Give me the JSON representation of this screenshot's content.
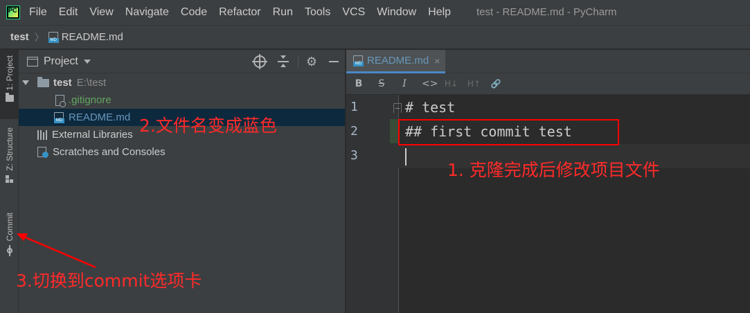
{
  "app": {
    "logo_text": "PC",
    "window_title": "test - README.md - PyCharm"
  },
  "menu": [
    "File",
    "Edit",
    "View",
    "Navigate",
    "Code",
    "Refactor",
    "Run",
    "Tools",
    "VCS",
    "Window",
    "Help"
  ],
  "breadcrumb": {
    "project": "test",
    "file": "README.md"
  },
  "tool_stripe": {
    "project": "1: Project",
    "structure": "Z: Structure",
    "commit": "Commit"
  },
  "project_panel": {
    "title": "Project",
    "tree": {
      "root_name": "test",
      "root_path": "E:\\test",
      "files": [
        ".gitignore",
        "README.md"
      ],
      "external": "External Libraries",
      "scratches": "Scratches and Consoles"
    }
  },
  "editor": {
    "tab_label": "README.md",
    "tab_close": "×",
    "toolbar": [
      "B",
      "S",
      "I",
      "<>",
      "H↓",
      "H↑",
      "🔗"
    ],
    "lines": [
      {
        "num": "1",
        "text": "# test"
      },
      {
        "num": "2",
        "text": "## first commit test"
      },
      {
        "num": "3",
        "text": ""
      }
    ]
  },
  "annotations": {
    "step1": "1. 克隆完成后修改项目文件",
    "step2": "2.文件名变成蓝色",
    "step3": "3.切换到commit选项卡"
  },
  "colors": {
    "annotation": "#ff2a2a",
    "modified_file": "#6897bb",
    "ignored_file": "#62a660",
    "selection": "#0d293e"
  }
}
